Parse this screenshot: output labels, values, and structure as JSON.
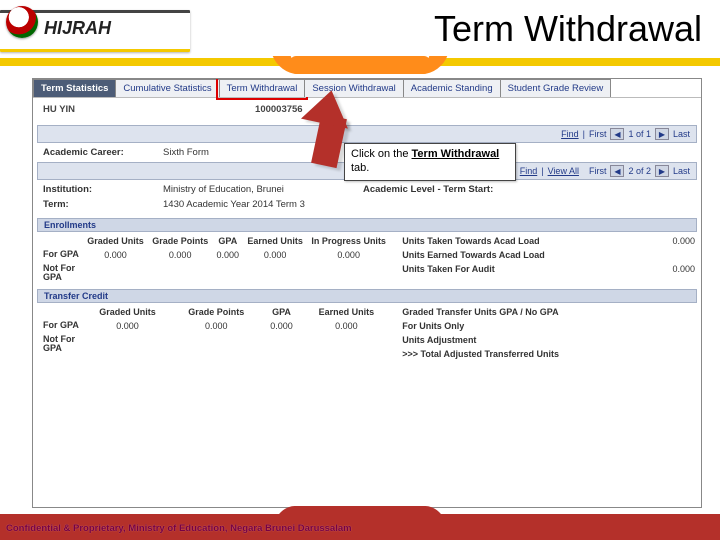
{
  "brand": "HIJRAH",
  "title": "Term Withdrawal",
  "tabs": [
    {
      "label": "Term Statistics",
      "active": true
    },
    {
      "label": "Cumulative Statistics"
    },
    {
      "label": "Term Withdrawal",
      "highlight": true
    },
    {
      "label": "Session Withdrawal"
    },
    {
      "label": "Academic Standing"
    },
    {
      "label": "Student Grade Review"
    }
  ],
  "student": {
    "name": "HU YIN",
    "id": "100003756"
  },
  "callout": {
    "pre": "Click on the ",
    "bold": "Term Withdrawal",
    "post": " tab."
  },
  "nav1": {
    "find": "Find",
    "first": "First",
    "pos": "1 of 1",
    "last": "Last"
  },
  "nav2": {
    "find": "Find",
    "viewall": "View All",
    "first": "First",
    "pos": "2 of 2",
    "last": "Last"
  },
  "career": {
    "label": "Academic Career:",
    "value": "Sixth Form"
  },
  "inst": {
    "label": "Institution:",
    "value": "Ministry of Education, Brunei",
    "label2": "Academic Level - Term Start:"
  },
  "term": {
    "label": "Term:",
    "value": "1430   Academic Year 2014 Term 3"
  },
  "band_enroll": "Enrollments",
  "band_transfer": "Transfer Credit",
  "grid_headers": [
    "Graded Units",
    "Grade Points",
    "GPA",
    "Earned Units",
    "In Progress Units"
  ],
  "grid_headers_tc": [
    "Graded Units",
    "Grade Points",
    "GPA",
    "Earned Units"
  ],
  "rows": {
    "for": "For GPA",
    "not": "Not For GPA"
  },
  "zero": "0.000",
  "right_enroll": [
    {
      "label": "Units Taken Towards Acad Load",
      "val": "0.000"
    },
    {
      "label": "Units Earned Towards Acad Load",
      "val": ""
    },
    {
      "label": "Units Taken For Audit",
      "val": "0.000"
    }
  ],
  "right_transfer": [
    {
      "label": "Graded Transfer Units GPA / No GPA",
      "val": ""
    },
    {
      "label": "For Units Only",
      "val": ""
    },
    {
      "label": "Units Adjustment",
      "val": ""
    },
    {
      "label": ">>> Total Adjusted Transferred Units",
      "val": ""
    }
  ],
  "confidential": "Confidential & Proprietary, Ministry of Education, Negara Brunei Darussalam"
}
